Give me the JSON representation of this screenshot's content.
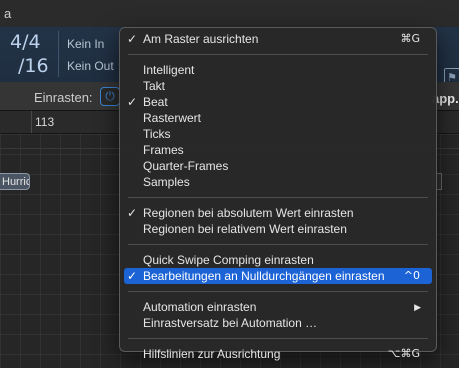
{
  "background": {
    "top_label": "a",
    "time_signature": {
      "numerator": "4/4",
      "denominator": "/16"
    },
    "in_label": "Kein In",
    "out_label": "Kein Out",
    "snap_label": "Einrasten:",
    "app_label": "app.",
    "ruler_number": "113",
    "region_label": "Hurric"
  },
  "menu": {
    "sections": [
      [
        {
          "label": "Am Raster ausrichten",
          "checked": true,
          "shortcut": "⌘G"
        }
      ],
      [
        {
          "label": "Intelligent",
          "checked": false
        },
        {
          "label": "Takt",
          "checked": false
        },
        {
          "label": "Beat",
          "checked": true
        },
        {
          "label": "Rasterwert",
          "checked": false
        },
        {
          "label": "Ticks",
          "checked": false
        },
        {
          "label": "Frames",
          "checked": false
        },
        {
          "label": "Quarter-Frames",
          "checked": false
        },
        {
          "label": "Samples",
          "checked": false
        }
      ],
      [
        {
          "label": "Regionen bei absolutem Wert einrasten",
          "checked": true
        },
        {
          "label": "Regionen bei relativem Wert einrasten",
          "checked": false
        }
      ],
      [
        {
          "label": "Quick Swipe Comping einrasten",
          "checked": false
        },
        {
          "label": "Bearbeitungen an Nulldurchgängen einrasten",
          "checked": true,
          "shortcut": "^0",
          "highlighted": true
        }
      ],
      [
        {
          "label": "Automation einrasten",
          "checked": false,
          "submenu": true
        },
        {
          "label": "Einrastversatz bei Automation …",
          "checked": false
        }
      ],
      [
        {
          "label": "Hilfslinien zur Ausrichtung",
          "checked": false,
          "shortcut": "⌥⌘G"
        }
      ]
    ]
  }
}
